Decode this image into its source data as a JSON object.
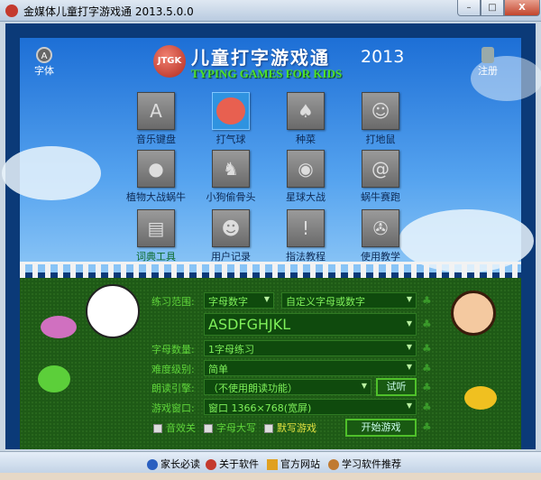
{
  "window": {
    "title": "金媒体儿童打字游戏通 2013.5.0.0",
    "min": "–",
    "max": "□",
    "close": "X"
  },
  "header": {
    "font_label": "字体",
    "register_label": "注册",
    "logo_badge": "JTGK",
    "logo_cn": "儿童打字游戏通",
    "logo_year": "2013",
    "logo_en": "TYPING GAMES FOR KIDS"
  },
  "games": [
    {
      "label": "音乐键盘",
      "icon": "A"
    },
    {
      "label": "打气球",
      "icon": ""
    },
    {
      "label": "种菜",
      "icon": "♠"
    },
    {
      "label": "打地鼠",
      "icon": "☺"
    },
    {
      "label": "植物大战蜗牛",
      "icon": "●"
    },
    {
      "label": "小狗偷骨头",
      "icon": "♞"
    },
    {
      "label": "星球大战",
      "icon": "◉"
    },
    {
      "label": "蜗牛赛跑",
      "icon": "@"
    },
    {
      "label": "词典工具",
      "icon": "▤"
    },
    {
      "label": "用户记录",
      "icon": "☻"
    },
    {
      "label": "指法教程",
      "icon": "!"
    },
    {
      "label": "使用教学",
      "icon": "✇"
    }
  ],
  "form": {
    "range_label": "练习范围:",
    "range_value": "字母数字",
    "range_custom": "自定义字母或数字",
    "letters_value": "ASDFGHJKL",
    "count_label": "字母数量:",
    "count_value": "1字母练习",
    "level_label": "难度级别:",
    "level_value": "简单",
    "voice_label": "朗读引擎:",
    "voice_value": "（不使用朗读功能）",
    "try_button": "试听",
    "window_label": "游戏窗口:",
    "window_value": "窗口 1366×768(宽屏)",
    "sound_off": "音效关",
    "uppercase": "字母大写",
    "dictation": "默写游戏",
    "start_button": "开始游戏"
  },
  "footer": {
    "items": [
      "家长必读",
      "关于软件",
      "官方网站",
      "学习软件推荐"
    ]
  }
}
